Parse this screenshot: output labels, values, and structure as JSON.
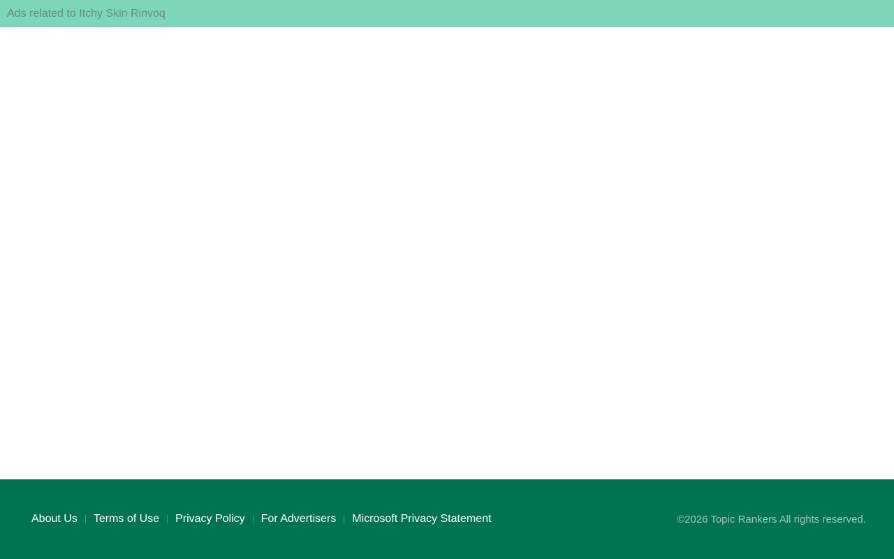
{
  "ads_bar": {
    "text": "Ads related to Itchy Skin Rinvoq"
  },
  "footer": {
    "links": [
      {
        "label": "About Us"
      },
      {
        "label": "Terms of Use"
      },
      {
        "label": "Privacy Policy"
      },
      {
        "label": "For Advertisers"
      },
      {
        "label": "Microsoft Privacy Statement"
      }
    ],
    "copyright": "©2026 Topic Rankers All rights reserved."
  },
  "colors": {
    "ads_bar_bg": "#7fd5bb",
    "footer_bg": "#007352",
    "link_text": "#ffffff"
  }
}
